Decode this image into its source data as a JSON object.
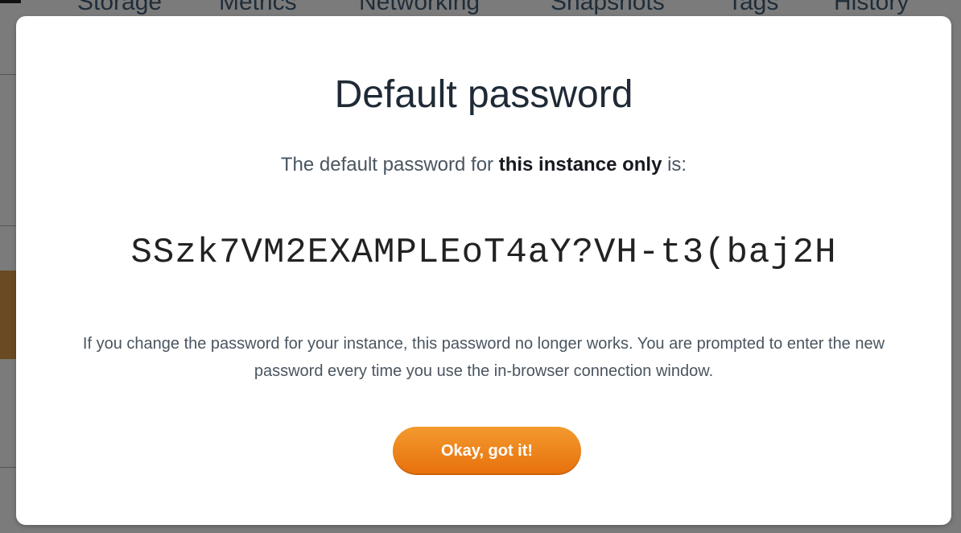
{
  "background": {
    "tabs": [
      "Storage",
      "Metrics",
      "Networking",
      "Snapshots",
      "Tags",
      "History"
    ]
  },
  "modal": {
    "title": "Default password",
    "subtitle_prefix": "The default password for ",
    "subtitle_bold": "this instance only",
    "subtitle_suffix": " is:",
    "password": "SSzk7VM2EXAMPLEoT4aY?VH-t3(baj2H",
    "warning_text": "If you change the password for your instance, this password no longer works. You are prompted to enter the new password every time you use the in-browser connection window.",
    "ok_button_label": "Okay, got it!"
  },
  "colors": {
    "accent": "#ec7211",
    "overlay": "#7b7b7b"
  }
}
